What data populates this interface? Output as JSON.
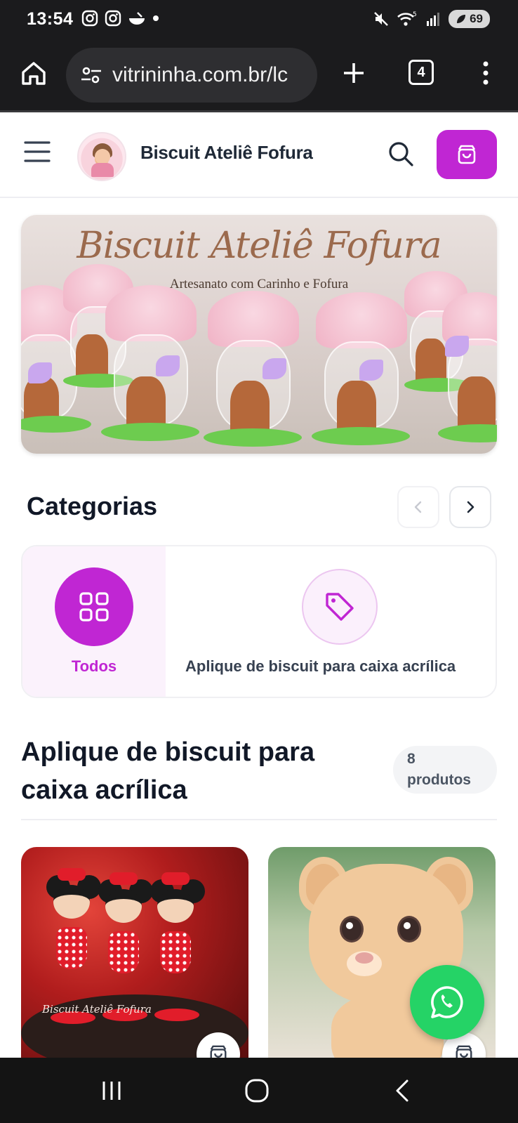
{
  "status_bar": {
    "time": "13:54",
    "battery": "69",
    "network": "5"
  },
  "browser": {
    "url": "vitrininha.com.br/lc",
    "tab_count": "4"
  },
  "header": {
    "store_name": "Biscuit Ateliê Fofura",
    "brand_color": "#c026d3"
  },
  "banner": {
    "title": "Biscuit Ateliê Fofura",
    "subtitle": "Artesanato com Carinho e Fofura"
  },
  "categories": {
    "title": "Categorias",
    "items": [
      {
        "label": "Todos",
        "icon": "grid-icon",
        "selected": true
      },
      {
        "label": "Aplique de biscuit para caixa acrílica",
        "icon": "tag-icon",
        "selected": false
      }
    ]
  },
  "section": {
    "title": "Aplique de biscuit para caixa acrílica",
    "count_number": "8",
    "count_label": "produtos"
  },
  "products": [
    {
      "image": "minnie-mouse-biscuit-figures",
      "watermark": "Biscuit Ateliê Fofura"
    },
    {
      "image": "lion-cub-biscuit-figure"
    }
  ],
  "colors": {
    "accent": "#c026d3",
    "whatsapp": "#25d366"
  }
}
